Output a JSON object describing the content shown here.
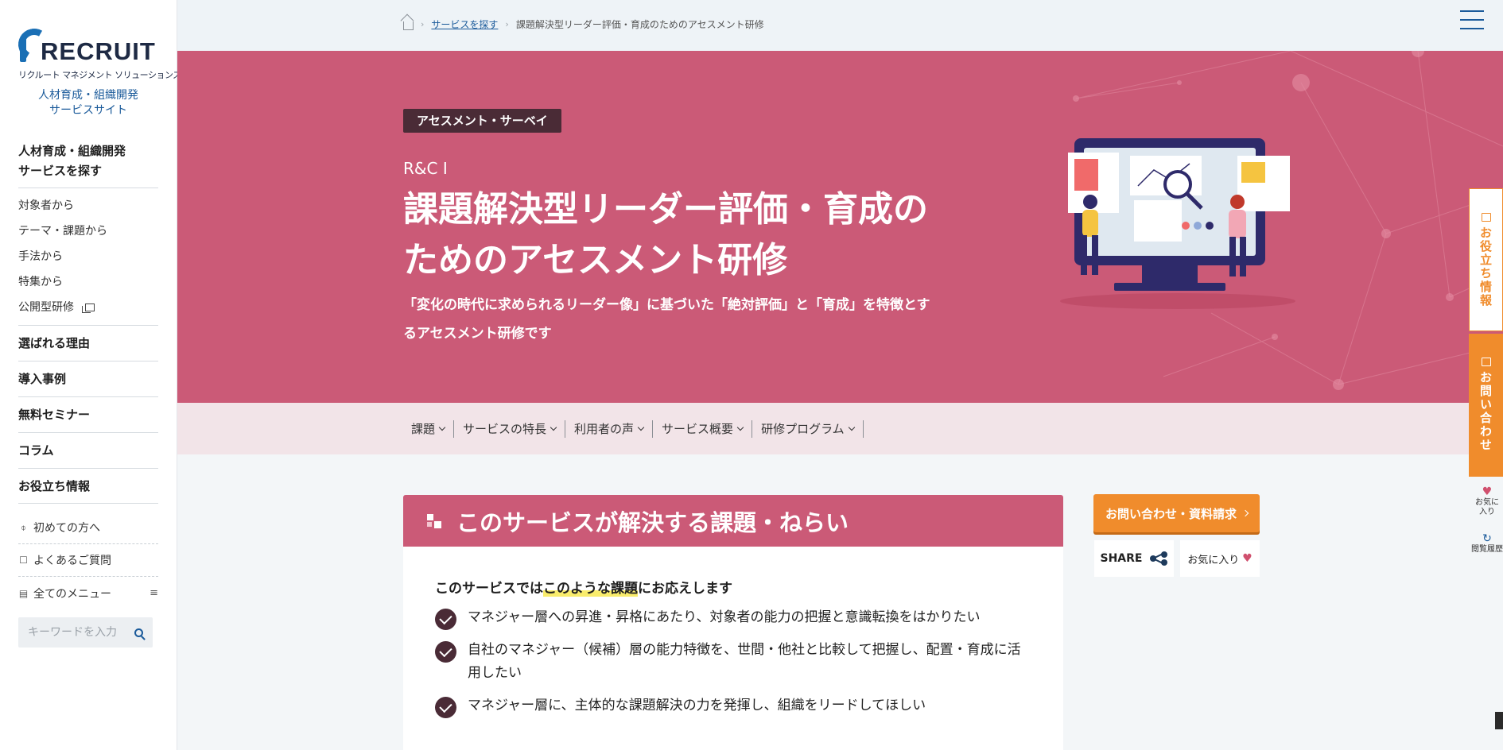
{
  "sidebar": {
    "logo_word": "RECRUIT",
    "logo_sub": "リクルート マネジメント ソリューションズ",
    "site_title_1": "人材育成・組織開発",
    "site_title_2": "サービスサイト",
    "heading_1": "人材育成・組織開発",
    "heading_2": "サービスを探す",
    "sub_items": [
      "対象者から",
      "テーマ・課題から",
      "手法から",
      "特集から",
      "公開型研修"
    ],
    "main_items": [
      "選ばれる理由",
      "導入事例",
      "無料セミナー",
      "コラム",
      "お役立ち情報"
    ],
    "util_items": [
      "初めての方へ",
      "よくあるご質問",
      "全てのメニュー"
    ],
    "search_placeholder": "キーワードを入力"
  },
  "breadcrumb": {
    "link": "サービスを探す",
    "current": "課題解決型リーダー評価・育成のためのアセスメント研修"
  },
  "hero": {
    "badge": "アセスメント・サーベイ",
    "subtitle": "R&C Ⅰ",
    "title_line1": "課題解決型リーダー評価・育成の",
    "title_line2": "ためのアセスメント研修",
    "desc_line1": "「変化の時代に求められるリーダー像」に基づいた「絶対評価」と「育成」を特徴とす",
    "desc_line2": "るアセスメント研修です",
    "bg_color": "#cb5a77"
  },
  "subnav": [
    "課題",
    "サービスの特長",
    "利用者の声",
    "サービス概要",
    "研修プログラム"
  ],
  "section": {
    "title": "このサービスが解決する課題・ねらい",
    "intro_pre": "このサービスでは",
    "intro_hl": "このような課題",
    "intro_post": "にお応えします",
    "items": [
      "マネジャー層への昇進・昇格にあたり、対象者の能力の把握と意識転換をはかりたい",
      "自社のマネジャー（候補）層の能力特徴を、世間・他社と比較して把握し、配置・育成に活用したい",
      "マネジャー層に、主体的な課題解決の力を発揮し、組織をリードしてほしい"
    ]
  },
  "cta": {
    "contact": "お問い合わせ・資料請求",
    "share": "SHARE",
    "favorite": "お気に入り"
  },
  "floating": {
    "info": "お役立ち情報",
    "contact": "お問い合わせ",
    "fav_line1": "お気に",
    "fav_line2": "入り",
    "history": "閲覧履歴"
  },
  "colors": {
    "accent": "#cb5a77",
    "cta": "#f08c2c",
    "brand_blue": "#1a6fb5",
    "dark": "#4a2b36"
  }
}
